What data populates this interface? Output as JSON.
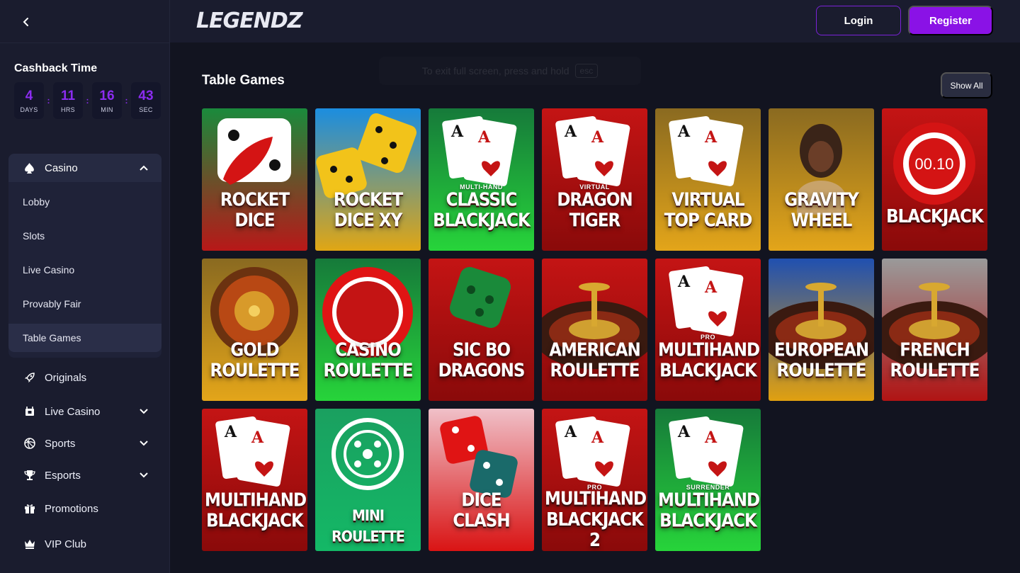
{
  "header": {
    "logo_text": "LEGENDZ",
    "login_label": "Login",
    "register_label": "Register"
  },
  "sidebar": {
    "cashback_title": "Cashback Time",
    "timer": [
      {
        "value": "4",
        "unit": "DAYS"
      },
      {
        "value": "11",
        "unit": "HRS"
      },
      {
        "value": "16",
        "unit": "MIN"
      },
      {
        "value": "43",
        "unit": "SEC"
      }
    ],
    "casino": {
      "label": "Casino",
      "items": [
        "Lobby",
        "Slots",
        "Live Casino",
        "Provably Fair",
        "Table Games"
      ],
      "active_item": "Table Games"
    },
    "nav": [
      {
        "label": "Originals",
        "icon": "rocket-icon"
      },
      {
        "label": "Live Casino",
        "icon": "live-casino-icon"
      },
      {
        "label": "Sports",
        "icon": "sports-ball-icon"
      },
      {
        "label": "Esports",
        "icon": "trophy-icon"
      },
      {
        "label": "Promotions",
        "icon": "gift-icon"
      },
      {
        "label": "VIP Club",
        "icon": "crown-icon"
      }
    ]
  },
  "main": {
    "fullscreen_hint": "To exit full screen, press and hold",
    "fullscreen_key": "esc",
    "section_title": "Table Games",
    "show_all_label": "Show All",
    "games": [
      {
        "line1": "ROCKET",
        "line2": "DICE",
        "sub": "",
        "theme": "green-red",
        "art": "rocket"
      },
      {
        "line1": "ROCKET",
        "line2": "DICE XY",
        "sub": "",
        "theme": "blue-yellow",
        "art": "dice-yellow"
      },
      {
        "line1": "CLASSIC",
        "line2": "BLACKJACK",
        "sub": "MULTI-HAND",
        "theme": "green",
        "art": "cards"
      },
      {
        "line1": "DRAGON",
        "line2": "TIGER",
        "sub": "VIRTUAL",
        "theme": "red",
        "art": "cards-dragon"
      },
      {
        "line1": "VIRTUAL",
        "line2": "TOP CARD",
        "sub": "",
        "theme": "gold",
        "art": "cards"
      },
      {
        "line1": "GRAVITY",
        "line2": "WHEEL",
        "sub": "",
        "theme": "gold",
        "art": "host"
      },
      {
        "line1": "BLACKJACK",
        "line2": "",
        "sub": "",
        "theme": "red",
        "art": "chip-timer"
      },
      {
        "line1": "GOLD",
        "line2": "ROULETTE",
        "sub": "",
        "theme": "gold",
        "art": "roulette"
      },
      {
        "line1": "CASINO",
        "line2": "ROULETTE",
        "sub": "",
        "theme": "green",
        "art": "chip"
      },
      {
        "line1": "SIC BO",
        "line2": "DRAGONS",
        "sub": "",
        "theme": "red",
        "art": "dice-green"
      },
      {
        "line1": "AMERICAN",
        "line2": "ROULETTE",
        "sub": "",
        "theme": "red",
        "art": "wheel"
      },
      {
        "line1": "MULTIHAND",
        "line2": "BLACKJACK",
        "sub": "PRO",
        "theme": "red",
        "art": "cards"
      },
      {
        "line1": "EUROPEAN",
        "line2": "ROULETTE",
        "sub": "",
        "theme": "blue-gold",
        "art": "wheel"
      },
      {
        "line1": "FRENCH",
        "line2": "ROULETTE",
        "sub": "",
        "theme": "grey-red",
        "art": "wheel"
      },
      {
        "line1": "MULTIHAND",
        "line2": "BLACKJACK",
        "sub": "",
        "theme": "red",
        "art": "cards"
      },
      {
        "line1": "MINI ROULETTE",
        "line2": "",
        "sub": "",
        "theme": "teal",
        "art": "mini-wheel"
      },
      {
        "line1": "DICE",
        "line2": "CLASH",
        "sub": "",
        "theme": "red-pink",
        "art": "dice-clash"
      },
      {
        "line1": "MULTIHAND",
        "line2": "BLACKJACK 2",
        "sub": "PRO",
        "theme": "red",
        "art": "cards"
      },
      {
        "line1": "MULTIHAND",
        "line2": "BLACKJACK",
        "sub": "SURRENDER",
        "theme": "green",
        "art": "cards"
      }
    ]
  },
  "colors": {
    "accent": "#8a12e6",
    "timer": "#8b2cf0",
    "background": "#121420",
    "sidebar": "#1a1c2e"
  }
}
